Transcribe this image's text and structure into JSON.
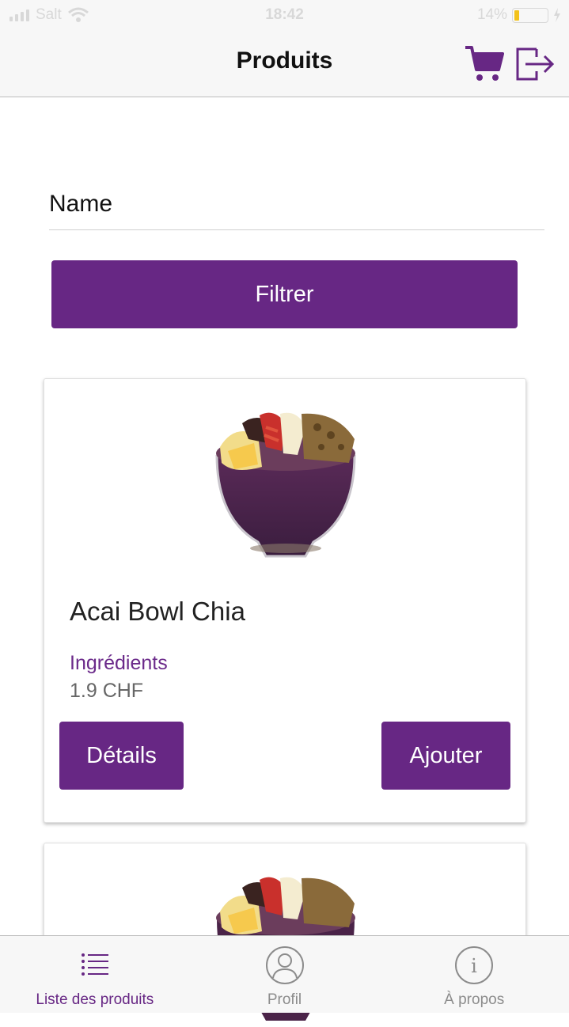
{
  "status_bar": {
    "carrier": "Salt",
    "time": "18:42",
    "battery_percent": "14%",
    "battery_level": 0.14
  },
  "header": {
    "title": "Produits",
    "cart_icon": "cart-icon",
    "logout_icon": "logout-icon"
  },
  "filter": {
    "name_placeholder": "Name",
    "button_label": "Filtrer"
  },
  "products": [
    {
      "name": "Acai Bowl Chia",
      "ingredients_label": "Ingrédients",
      "price": "1.9 CHF",
      "details_label": "Détails",
      "add_label": "Ajouter"
    }
  ],
  "tabs": [
    {
      "label": "Liste des produits",
      "icon": "list-icon",
      "active": true
    },
    {
      "label": "Profil",
      "icon": "profile-icon",
      "active": false
    },
    {
      "label": "À propos",
      "icon": "info-icon",
      "active": false
    }
  ],
  "colors": {
    "accent": "#672784",
    "ingredients_text": "#6b2a8a",
    "price_text": "#666666",
    "inactive_tab": "#8c8c8c"
  }
}
